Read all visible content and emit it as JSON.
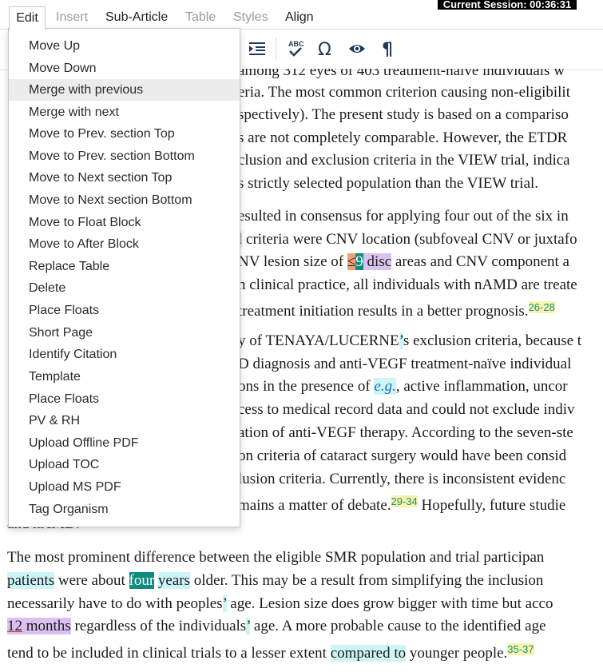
{
  "session": {
    "text": "Current Session: 00:36:31"
  },
  "menubar": {
    "items": [
      {
        "label": "Edit",
        "state": "active"
      },
      {
        "label": "Insert",
        "state": "disabled"
      },
      {
        "label": "Sub-Article",
        "state": "enabled"
      },
      {
        "label": "Table",
        "state": "disabled"
      },
      {
        "label": "Styles",
        "state": "disabled"
      },
      {
        "label": "Align",
        "state": "enabled"
      }
    ]
  },
  "toolbar": {
    "icons": [
      "indent-icon",
      "spellcheck-icon",
      "omega-icon",
      "eye-icon",
      "pilcrow-icon"
    ]
  },
  "edit_menu": {
    "highlighted": "Merge with previous",
    "items": [
      "Move Up",
      "Move Down",
      "Merge with previous",
      "Merge with next",
      "Move to Prev. section Top",
      "Move to Prev. section Bottom",
      "Move to Next section Top",
      "Move to Next section Bottom",
      "Move to Float Block",
      "Move to After Block",
      "Replace Table",
      "Delete",
      "Place Floats",
      "Short Page",
      "Identify Citation",
      "Template",
      "Place Floats",
      "PV & RH",
      "Upload Offline PDF",
      "Upload TOC",
      "Upload MS PDF",
      "Tag Organism"
    ]
  },
  "article": {
    "p1": {
      "l0": "among 312 eyes of 403 treatment-naïve individuals w",
      "l1": "eria. The most common criterion causing non-eligibilit",
      "l2": "spectively). The present study is based on a compariso",
      "l3": "s are not completely comparable. However, the ETDR",
      "l4": "clusion and exclusion criteria in the VIEW trial, indica",
      "l5": "s strictly selected population than the VIEW trial."
    },
    "p2": {
      "l1": "esulted in consensus for applying four out of the six in",
      "l2a": "l",
      "l2b": " criteria were CNV location (subfoveal CNV or juxtafo",
      "l3a": "NV lesion size of ",
      "l3le": "≤",
      "l3num": "9",
      "l3disc": " disc",
      "l3b": " areas and CNV component a",
      "l4": "n clinical practice, all individuals with nAMD are treate",
      "l5": "treatment initiation results in a better prognosis.",
      "l5ref": "26-28"
    },
    "p3": {
      "l1a": "y of TENAYA/LUCERNE",
      "l1q": "’",
      "l1b": "s exclusion criteria, because t",
      "l2": "D diagnosis and anti-VEGF treatment-naïve individual",
      "l3a": "ons in the presence of ",
      "l3eg": "e.g.",
      "l3b": ", active inflammation, uncor",
      "l4": "cess to medical record data and could not exclude indiv",
      "l5": "ation of anti-VEGF therapy. According to the seven-ste",
      "l6": "on criteria of cataract surgery would have been consid",
      "l7": "lusion criteria. Currently, there is inconsistent evidenc",
      "l8a": "mains a matter of debate.",
      "l8ref": "29-34",
      "l8b": " Hopefully, future studie",
      "l9": "and nAMD."
    },
    "p4": {
      "l1": "The most prominent difference between the eligible SMR population and trial participan",
      "l2a": "patients",
      "l2b": " were about ",
      "l2c": "four",
      "l2d": " ",
      "l2e": "years",
      "l2f": " older. This may be a result from simplifying the inclusion",
      "l3a": "necessarily have to do with peoples",
      "l3q": "’",
      "l3b": " age. Lesion size does grow bigger with time but acco",
      "l4a": "12",
      "l4b": " months",
      "l4c": " regardless of the individuals",
      "l4q": "’",
      "l4d": " age. A more probable cause to the identified age",
      "l5a": "tend to be included in clinical trials to a lesser extent ",
      "l5b": "compared to",
      "l5c": " younger people.",
      "l5ref": "35-37"
    }
  }
}
